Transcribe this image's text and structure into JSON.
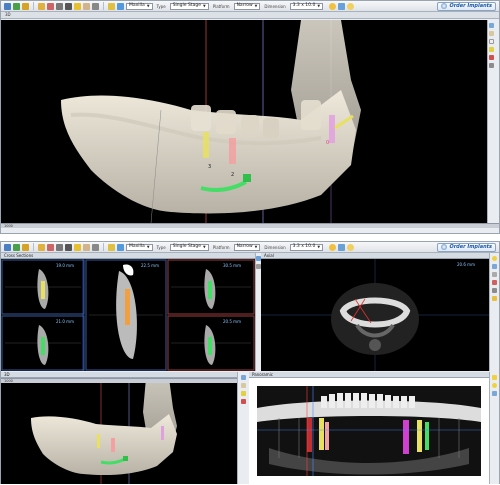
{
  "toolbar": {
    "arch_value": "Maxilla",
    "type_label": "Type",
    "type_value": "Single Stage",
    "platform_label": "Platform",
    "platform_value": "Narrow",
    "dimension_label": "Dimension",
    "dimension_value": "3.3 x 10.0",
    "order_button": "Order Implants"
  },
  "top_window": {
    "subtab": "3D",
    "ruler_value": "1000",
    "implant_labels": [
      "3",
      "2",
      "0"
    ]
  },
  "bottom_window": {
    "cross_sections_title": "Cross Sections",
    "axial_title": "Axial",
    "axial_readout": "20.6 mm",
    "panoramic_title": "Panoramic",
    "view3d_title": "3D",
    "ruler_value": "1000",
    "cross_sections": [
      {
        "label": "19.0 mm"
      },
      {
        "label": "22.5 mm"
      },
      {
        "label": "30.5 mm"
      },
      {
        "label": "21.0 mm"
      },
      {
        "label": "20.5 mm"
      }
    ]
  },
  "colors": {
    "accent": "#1b5aa6",
    "implant_yellow": "#e8e060",
    "implant_pink": "#f3a0a0",
    "nerve_green": "#44dd66",
    "ruler_blue": "#7fb4ff",
    "ruler_red": "#ff5555"
  }
}
